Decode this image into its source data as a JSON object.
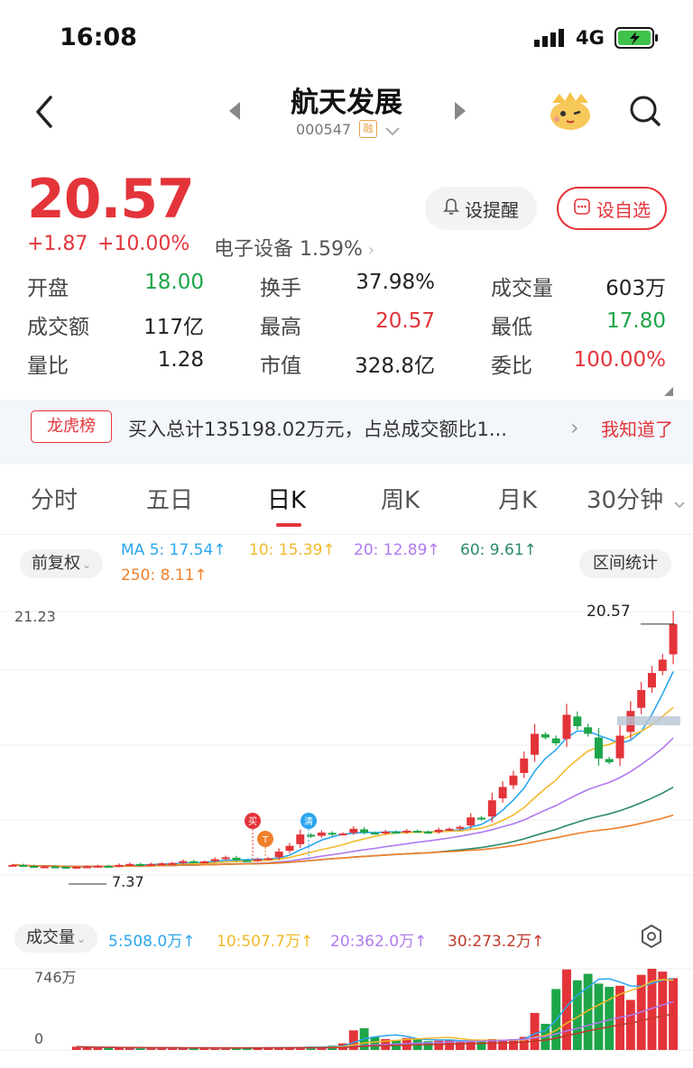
{
  "status": {
    "time": "16:08",
    "network": "4G"
  },
  "header": {
    "title": "航天发展",
    "code": "000547",
    "code_tag": "融"
  },
  "quote": {
    "price": "20.57",
    "change": "+1.87",
    "change_pct": "+10.00%",
    "sector": "电子设备 1.59%",
    "remind_label": "设提醒",
    "fav_label": "设自选"
  },
  "stats": [
    {
      "label": "开盘",
      "value": "18.00",
      "color": "#1ea54a"
    },
    {
      "label": "换手",
      "value": "37.98%",
      "color": "#222222"
    },
    {
      "label": "成交量",
      "value": "603万",
      "color": "#222222"
    },
    {
      "label": "成交额",
      "value": "117亿",
      "color": "#222222"
    },
    {
      "label": "最高",
      "value": "20.57",
      "color": "#e3343a"
    },
    {
      "label": "最低",
      "value": "17.80",
      "color": "#1ea54a"
    },
    {
      "label": "量比",
      "value": "1.28",
      "color": "#222222"
    },
    {
      "label": "市值",
      "value": "328.8亿",
      "color": "#222222"
    },
    {
      "label": "委比",
      "value": "100.00%",
      "color": "#e3343a"
    }
  ],
  "banner": {
    "tag": "龙虎榜",
    "text": "买入总计135198.02万元，占总成交额比1...",
    "action": "我知道了"
  },
  "tabs": [
    "分时",
    "五日",
    "日K",
    "周K",
    "月K",
    "30分钟"
  ],
  "chart_panel": {
    "adjust_label": "前复权",
    "range_stats_label": "区间统计",
    "ma": [
      {
        "label": "MA 5: 17.54↑",
        "color": "#2aa6ee"
      },
      {
        "label": "10: 15.39↑",
        "color": "#f2b92a"
      },
      {
        "label": "20: 12.89↑",
        "color": "#b07af0"
      },
      {
        "label": "60: 9.61↑",
        "color": "#2a8a6a"
      },
      {
        "label": "250: 8.11↑",
        "color": "#f07f2a"
      }
    ],
    "price_top_label": "21.23",
    "price_high_label": "20.57",
    "price_low_label": "7.37",
    "markers": [
      "买",
      "T",
      "清"
    ]
  },
  "volume_panel": {
    "label": "成交量",
    "ma": [
      {
        "label": "5:508.0万↑",
        "color": "#2aa6ee"
      },
      {
        "label": "10:507.7万↑",
        "color": "#f2b92a"
      },
      {
        "label": "20:362.0万↑",
        "color": "#b07af0"
      },
      {
        "label": "30:273.2万↑",
        "color": "#c0392b"
      }
    ],
    "max_label": "746万",
    "zero_label": "0"
  },
  "chart_data": {
    "type": "candlestick",
    "price_range": [
      7.37,
      21.23
    ],
    "closes": [
      7.9,
      7.85,
      7.8,
      7.82,
      7.8,
      7.78,
      7.8,
      7.82,
      7.85,
      7.83,
      7.9,
      7.95,
      7.92,
      7.95,
      7.98,
      8.0,
      8.1,
      8.05,
      8.08,
      8.2,
      8.3,
      8.15,
      8.12,
      8.2,
      8.25,
      8.6,
      8.9,
      9.5,
      9.4,
      9.6,
      9.5,
      9.55,
      9.8,
      9.6,
      9.55,
      9.65,
      9.6,
      9.7,
      9.65,
      9.6,
      9.75,
      9.8,
      9.9,
      10.4,
      10.3,
      11.3,
      12.0,
      12.6,
      13.5,
      14.8,
      14.6,
      14.3,
      15.8,
      15.2,
      14.8,
      13.5,
      13.3,
      14.7,
      16.0,
      17.1,
      18.0,
      18.7,
      20.57
    ],
    "volumes": [
      30,
      25,
      20,
      22,
      18,
      20,
      15,
      18,
      20,
      18,
      15,
      20,
      18,
      16,
      15,
      18,
      22,
      20,
      25,
      20,
      28,
      25,
      30,
      28,
      40,
      60,
      180,
      200,
      120,
      100,
      90,
      110,
      95,
      80,
      85,
      90,
      75,
      80,
      95,
      100,
      85,
      100,
      120,
      340,
      240,
      560,
      740,
      640,
      700,
      610,
      580,
      590,
      460,
      690,
      746,
      720,
      660
    ]
  }
}
